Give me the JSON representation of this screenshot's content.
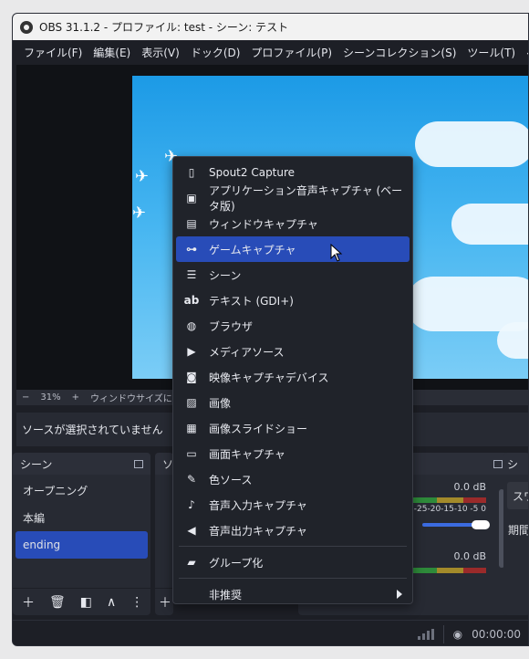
{
  "window": {
    "title": "OBS 31.1.2 - プロファイル: test - シーン: テスト"
  },
  "menu": [
    "ファイル(F)",
    "編集(E)",
    "表示(V)",
    "ドック(D)",
    "プロファイル(P)",
    "シーンコレクション(S)",
    "ツール(T)",
    "ヘルプ(H)"
  ],
  "zoombar": {
    "minus": "−",
    "zoom": "31%",
    "plus": "+",
    "fit": "ウィンドウサイズにス"
  },
  "properties": {
    "empty_text": "ソースが選択されていません"
  },
  "scenes_dock": {
    "title": "シーン",
    "items": [
      {
        "label": "オープニング"
      },
      {
        "label": "本編"
      },
      {
        "label": "ending"
      }
    ],
    "selected_index": 2
  },
  "sources_dock": {
    "title": "ソ"
  },
  "mixer": {
    "level1": "0.0 dB",
    "ticks": "-25-20-15-10 -5 0",
    "level2": "0.0 dB"
  },
  "transitions_dock": {
    "title": "シ",
    "button": "スワ",
    "period_label": "期間"
  },
  "status": {
    "rec_time": "00:00:00"
  },
  "context_menu": {
    "items": [
      {
        "label": "Spout2 Capture",
        "icon": "document-icon"
      },
      {
        "label": "アプリケーション音声キャプチャ (ベータ版)",
        "icon": "app-audio-icon"
      },
      {
        "label": "ウィンドウキャプチャ",
        "icon": "window-icon"
      },
      {
        "label": "ゲームキャプチャ",
        "icon": "gamepad-icon"
      },
      {
        "label": "シーン",
        "icon": "list-icon"
      },
      {
        "label": "テキスト (GDI+)",
        "icon": "text-icon"
      },
      {
        "label": "ブラウザ",
        "icon": "globe-icon"
      },
      {
        "label": "メディアソース",
        "icon": "play-icon"
      },
      {
        "label": "映像キャプチャデバイス",
        "icon": "camera-icon"
      },
      {
        "label": "画像",
        "icon": "image-icon"
      },
      {
        "label": "画像スライドショー",
        "icon": "slideshow-icon"
      },
      {
        "label": "画面キャプチャ",
        "icon": "monitor-icon"
      },
      {
        "label": "色ソース",
        "icon": "brush-icon"
      },
      {
        "label": "音声入力キャプチャ",
        "icon": "microphone-icon"
      },
      {
        "label": "音声出力キャプチャ",
        "icon": "speaker-icon"
      }
    ],
    "group_label": "グループ化",
    "deprecated_label": "非推奨",
    "highlighted_index": 3
  },
  "colors": {
    "accent": "#284cb8",
    "bg": "#1d1f26",
    "panel": "#272a33"
  }
}
